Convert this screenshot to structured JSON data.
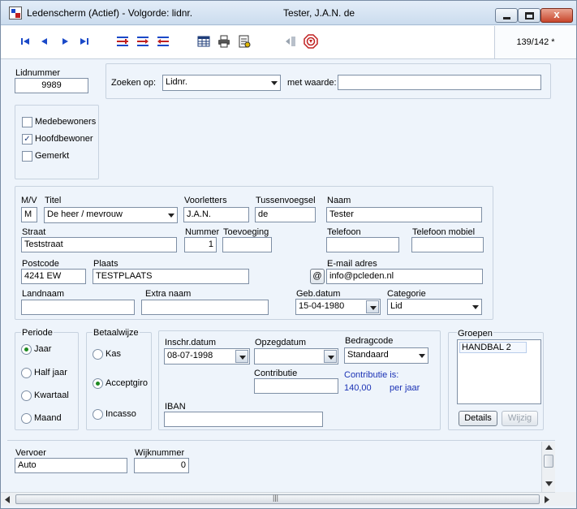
{
  "window": {
    "title": "Ledenscherm (Actief) - Volgorde: lidnr.",
    "member_title": "Tester, J.A.N. de",
    "close_glyph": "x"
  },
  "toolbar": {
    "record_count": "139/142 *",
    "icons": [
      "first-record-icon",
      "previous-record-icon",
      "next-record-icon",
      "last-record-icon",
      "insert-record-icon",
      "edit-record-icon",
      "delete-record-icon",
      "table-view-icon",
      "print-icon",
      "report-icon",
      "exit-icon",
      "stop-icon"
    ]
  },
  "lid": {
    "label": "Lidnummer",
    "value": "9989"
  },
  "search": {
    "label": "Zoeken op:",
    "field": "Lidnr.",
    "value_label": "met waarde:",
    "value": ""
  },
  "checks": [
    {
      "label": "Medebewoners",
      "checked": false
    },
    {
      "label": "Hoofdbewoner",
      "checked": true
    },
    {
      "label": "Gemerkt",
      "checked": false
    }
  ],
  "check_mark": "✓",
  "person": {
    "mv_label": "M/V",
    "mv": "M",
    "titel_label": "Titel",
    "titel": "De heer / mevrouw",
    "voorletters_label": "Voorletters",
    "voorletters": "J.A.N.",
    "tussenvoegsel_label": "Tussenvoegsel",
    "tussenvoegsel": "de",
    "naam_label": "Naam",
    "naam": "Tester",
    "straat_label": "Straat",
    "straat": "Teststraat",
    "nummer_label": "Nummer",
    "nummer": "1",
    "toevoeging_label": "Toevoeging",
    "toevoeging": "",
    "telefoon_label": "Telefoon",
    "telefoon": "",
    "telefoon_mobiel_label": "Telefoon mobiel",
    "telefoon_mobiel": "",
    "postcode_label": "Postcode",
    "postcode": "4241 EW",
    "plaats_label": "Plaats",
    "plaats": "TESTPLAATS",
    "email_label": "E-mail adres",
    "email": "info@pcleden.nl",
    "email_button": "@",
    "landnaam_label": "Landnaam",
    "landnaam": "",
    "extra_naam_label": "Extra naam",
    "extra_naam": "",
    "gebdatum_label": "Geb.datum",
    "gebdatum": "15-04-1980",
    "categorie_label": "Categorie",
    "categorie": "Lid"
  },
  "periode": {
    "label": "Periode",
    "options": [
      "Jaar",
      "Half jaar",
      "Kwartaal",
      "Maand"
    ],
    "selected": "Jaar"
  },
  "betaalwijze": {
    "label": "Betaalwijze",
    "options": [
      "Kas",
      "Acceptgiro",
      "Incasso"
    ],
    "selected": "Acceptgiro"
  },
  "finance": {
    "inschr_label": "Inschr.datum",
    "inschr": "08-07-1998",
    "opzeg_label": "Opzegdatum",
    "opzeg": "  -  -",
    "bedragcode_label": "Bedragcode",
    "bedragcode": "Standaard",
    "contributie_label": "Contributie",
    "contributie": "",
    "contributie_is_label": "Contributie is:",
    "contributie_is_value": "140,00",
    "contributie_is_unit": "per jaar",
    "iban_label": "IBAN",
    "iban": ""
  },
  "groepen": {
    "label": "Groepen",
    "items": [
      "HANDBAL 2"
    ],
    "details_button": "Details",
    "wijzig_button": "Wijzig"
  },
  "extra": {
    "vervoer_label": "Vervoer",
    "vervoer": "Auto",
    "wijknummer_label": "Wijknummer",
    "wijknummer": "0"
  },
  "scrollbar": {
    "h_grip": "|||"
  },
  "colors": {
    "accent": "#1a49c8",
    "link_blue": "#1b32b5",
    "radio_green": "#1e8a21",
    "close_red": "#c8452b"
  }
}
